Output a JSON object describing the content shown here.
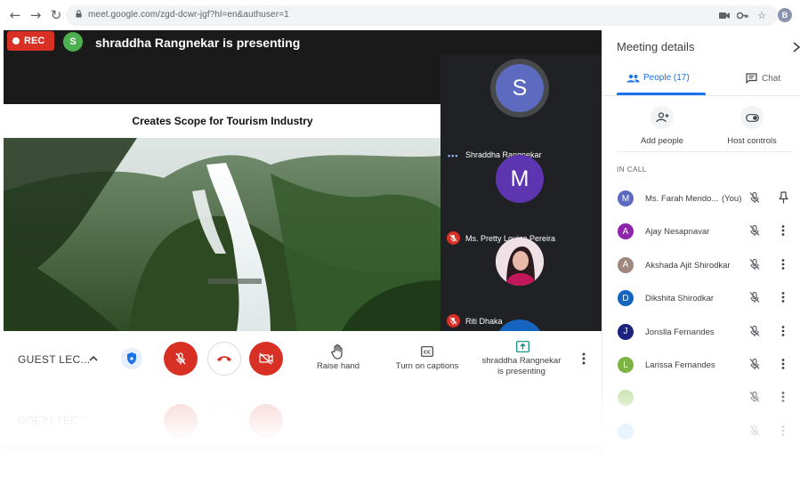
{
  "browser": {
    "url": "meet.google.com/zgd-dcwr-jgf?hl=en&authuser=1",
    "profile_initial": "B",
    "icons": [
      "back-icon",
      "forward-icon",
      "reload-icon",
      "lock-icon",
      "camera-icon",
      "key-icon",
      "star-icon"
    ]
  },
  "stage": {
    "rec_label": "REC",
    "presenter_initial": "S",
    "presenter_text": "shraddha Rangnekar is presenting",
    "slide_title": "Creates Scope for Tourism Industry",
    "tiles": [
      {
        "initial": "S",
        "name": "Shraddha Rangnekar",
        "speaking": true,
        "color": "#5c6bc0"
      },
      {
        "initial": "M",
        "name": "Ms. Pretty Louiza Pereira",
        "muted": true,
        "color": "#5e35b1"
      },
      {
        "name": "Riti Dhaka",
        "muted": true,
        "has_photo": true
      },
      {
        "initial": "",
        "color": "#1565c0"
      }
    ]
  },
  "controls": {
    "meeting_name": "GUEST LEC...",
    "raise_hand": "Raise hand",
    "captions": "Turn on captions",
    "presenting_line1": "shraddha Rangnekar",
    "presenting_line2": "is presenting",
    "colors": {
      "red": "#d93025",
      "accent": "#1a73e8"
    }
  },
  "panel": {
    "title": "Meeting details",
    "tab_people": "People (17)",
    "tab_chat": "Chat",
    "add_people": "Add people",
    "host_controls": "Host controls",
    "in_call": "IN CALL",
    "people": [
      {
        "initial": "M",
        "name": "Ms. Farah Mendo...",
        "you": "(You)",
        "color": "#5c6bc0"
      },
      {
        "initial": "A",
        "name": "Ajay Nesapnavar",
        "color": "#8e24aa"
      },
      {
        "initial": "A",
        "name": "Akshada Ajit Shirodkar",
        "color": "#a1887f"
      },
      {
        "initial": "D",
        "name": "Dikshita Shirodkar",
        "color": "#1565c0"
      },
      {
        "initial": "J",
        "name": "Jonslla Fernandes",
        "color": "#1a237e"
      },
      {
        "initial": "L",
        "name": "Larissa Fernandes",
        "color": "#7cb342"
      },
      {
        "initial": "",
        "name": "",
        "color": "#c5e1a5"
      },
      {
        "initial": "",
        "name": "",
        "color": "#90caf9"
      }
    ]
  }
}
